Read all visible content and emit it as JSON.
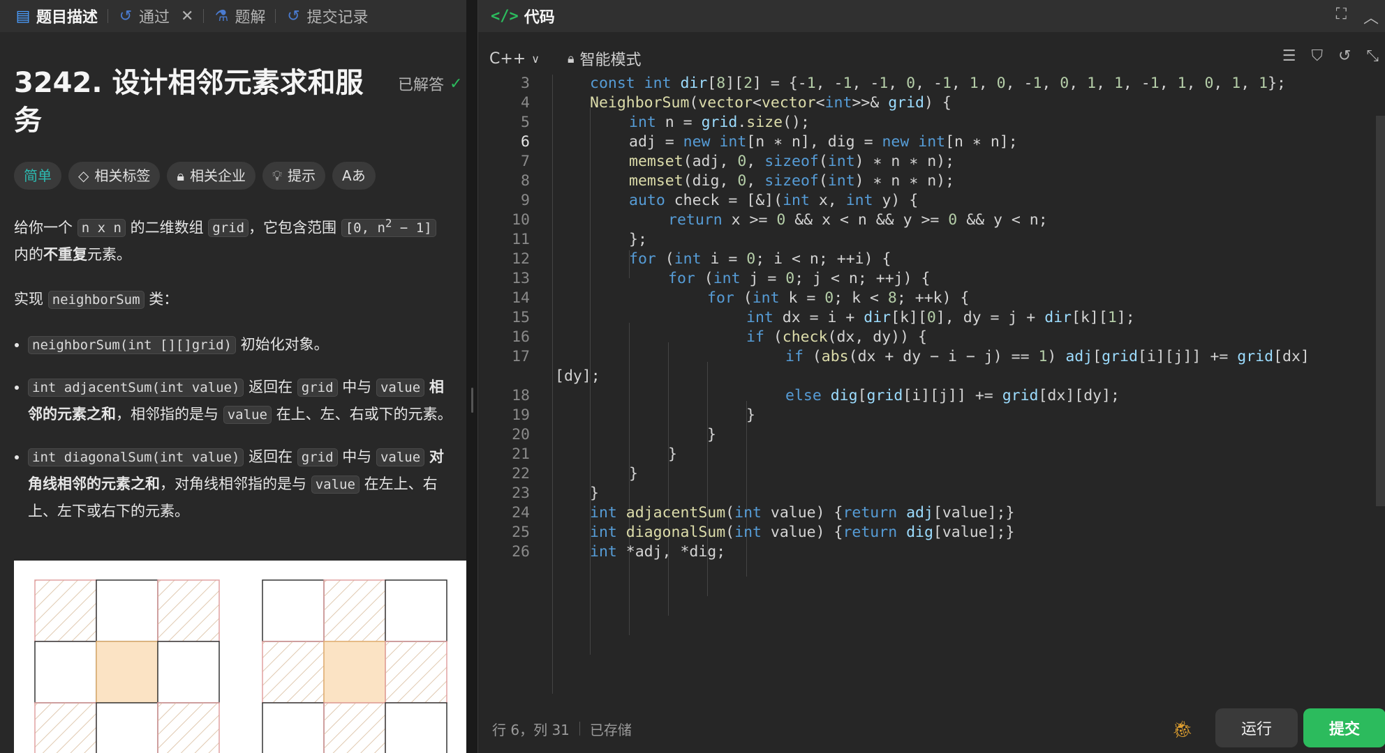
{
  "left_tabs": [
    {
      "label": "题目描述",
      "icon": "document-icon"
    },
    {
      "label": "通过",
      "icon": "history-icon"
    },
    {
      "label": "题解",
      "icon": "flask-icon"
    },
    {
      "label": "提交记录",
      "icon": "history-icon"
    }
  ],
  "problem": {
    "title": "3242. 设计相邻元素求和服务",
    "solved_label": "已解答",
    "chips": {
      "difficulty": "简单",
      "tags": "相关标签",
      "companies": "相关企业",
      "hint": "提示",
      "font": "Aあ"
    },
    "desc1_a": "给你一个",
    "code_nxn": "n x n",
    "desc1_b": "的二维数组",
    "code_grid": "grid",
    "desc1_c": "，它包含范围",
    "code_range_a": "[0, n",
    "code_range_sup": "2",
    "code_range_b": " − 1]",
    "desc1_d": "内的",
    "desc1_bold": "不重复",
    "desc1_e": "元素。",
    "desc2_a": "实现",
    "code_class": "neighborSum",
    "desc2_b": "类：",
    "b1_code": "neighborSum(int [][]grid)",
    "b1_text": "初始化对象。",
    "b2_code": "int adjacentSum(int value)",
    "b2_a": "返回在",
    "b2_b": "中与",
    "b2_c": "相邻的元素之和",
    "b2_d": "，相邻指的是与",
    "b2_e": "在上、左、右或下的元素。",
    "b3_code": "int diagonalSum(int value)",
    "b3_a": "返回在",
    "b3_b": "中与",
    "b3_c": "对角线相邻的元素之和",
    "b3_d": "，对角线相邻指的是与",
    "b3_e": "在左上、右上、左下或右下的元素。",
    "code_value": "value"
  },
  "editor": {
    "header_title": "代码",
    "language": "C++",
    "mode": "智能模式",
    "status_pos": "行 6，列 31",
    "status_saved": "已存储",
    "run_label": "运行",
    "submit_label": "提交",
    "current_line": 6,
    "line_numbers": [
      "3",
      "4",
      "5",
      "6",
      "7",
      "8",
      "9",
      "10",
      "11",
      "12",
      "13",
      "14",
      "15",
      "16",
      "17",
      "",
      "18",
      "19",
      "20",
      "21",
      "22",
      "23",
      "24",
      "25",
      "26"
    ]
  },
  "colors": {
    "accent_green": "#2cbb5d",
    "easy_teal": "#2cbbb1",
    "highlight": "#fbe3c4"
  }
}
